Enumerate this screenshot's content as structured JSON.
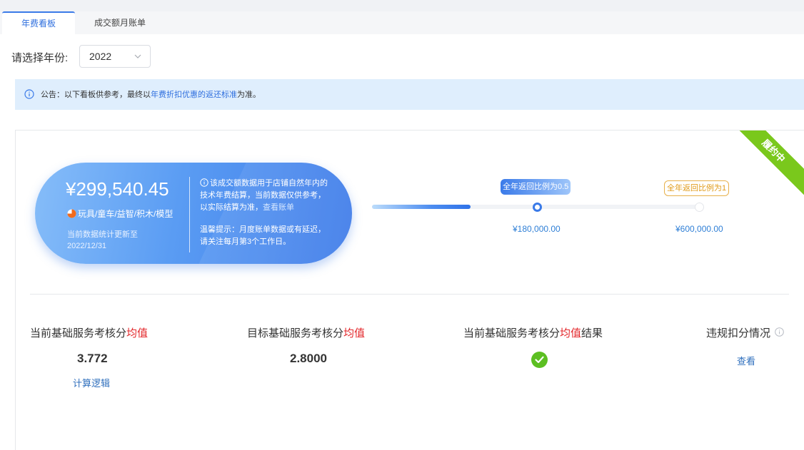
{
  "tabs": [
    {
      "label": "年费看板",
      "active": true
    },
    {
      "label": "成交额月账单",
      "active": false
    }
  ],
  "year_filter": {
    "label": "请选择年份:",
    "selected": "2022"
  },
  "notice": {
    "icon": "info-icon",
    "prefix": "公告：以下看板供参考，最终以",
    "link": "年费折扣优惠的返还标准",
    "suffix": "为准。"
  },
  "status_ribbon": "履约中",
  "summary": {
    "amount": "¥299,540.45",
    "category": "玩具/童车/益智/积木/模型",
    "update_prefix": "当前数据统计更新至",
    "update_date": "2022/12/31",
    "description": "该成交额数据用于店铺自然年内的技术年费结算，当前数据仅供参考，以实际结算为准，",
    "bill_link": "查看账单",
    "tip": "温馨提示：月度账单数据或有延迟，请关注每月第3个工作日。"
  },
  "progress": {
    "current_fraction": 0.3,
    "milestones": [
      {
        "tag": "全年返回比例为0.5",
        "amount": "¥180,000.00",
        "reached": true
      },
      {
        "tag": "全年返回比例为1",
        "amount": "¥600,000.00",
        "reached": false
      }
    ]
  },
  "stats": {
    "current": {
      "title_prefix": "当前基础服务考核分",
      "title_highlight": "均值",
      "value": "3.772",
      "link": "计算逻辑"
    },
    "target": {
      "title_prefix": "目标基础服务考核分",
      "title_highlight": "均值",
      "value": "2.8000"
    },
    "result": {
      "title_prefix": "当前基础服务考核分",
      "title_highlight": "均值",
      "title_suffix": "结果",
      "icon": "check-circle-icon"
    },
    "violation": {
      "title": "违规扣分情况",
      "icon": "info-icon",
      "link": "查看"
    }
  },
  "colors": {
    "primary": "#3a7ae8",
    "highlight_red": "#e3262a",
    "success": "#5cbf22",
    "ribbon": "#7ac81c",
    "notice_bg": "#dfeefd",
    "milestone_pending": "#e09b1a"
  }
}
